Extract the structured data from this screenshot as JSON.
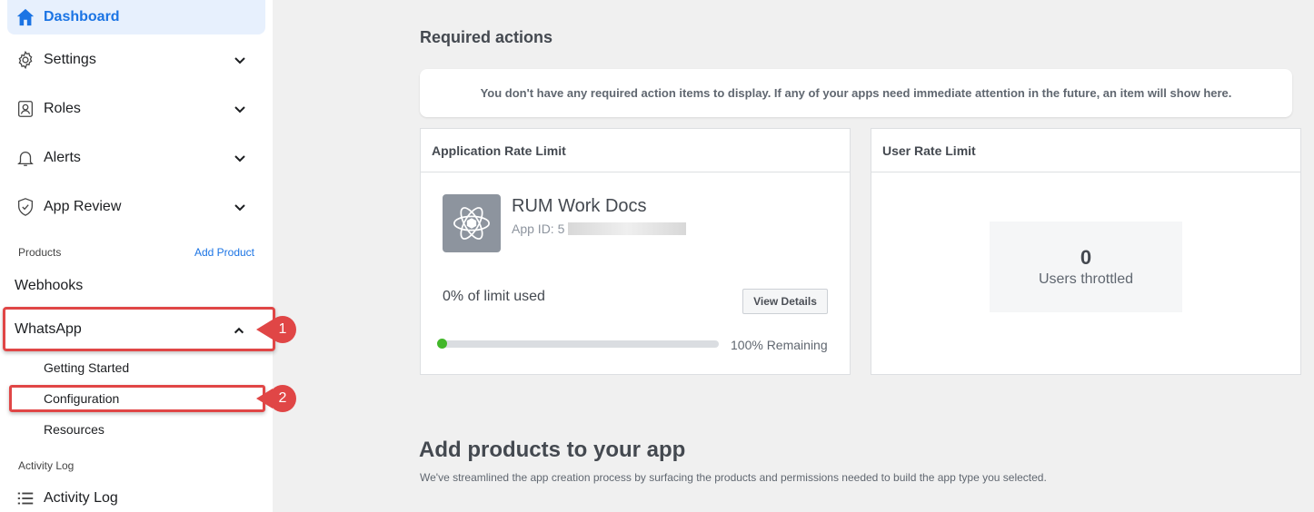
{
  "sidebar": {
    "dashboard": "Dashboard",
    "items": [
      {
        "label": "Settings",
        "icon": "gear-icon"
      },
      {
        "label": "Roles",
        "icon": "roles-icon"
      },
      {
        "label": "Alerts",
        "icon": "bell-icon"
      },
      {
        "label": "App Review",
        "icon": "shield-check-icon"
      }
    ],
    "products_heading": "Products",
    "add_product": "Add Product",
    "webhooks": "Webhooks",
    "whatsapp": "WhatsApp",
    "whatsapp_sub": [
      "Getting Started",
      "Configuration",
      "Resources"
    ],
    "activity_heading": "Activity Log",
    "activity_item": "Activity Log"
  },
  "callouts": [
    "1",
    "2"
  ],
  "main": {
    "required_title": "Required actions",
    "notice": "You don't have any required action items to display. If any of your apps need immediate attention in the future, an item will show here.",
    "app_rate": {
      "title": "Application Rate Limit",
      "app_name": "RUM Work Docs",
      "app_id_label": "App ID: 5",
      "limit_used": "0% of limit used",
      "view_details": "View Details",
      "remaining": "100% Remaining",
      "progress_fraction": 0.0
    },
    "user_rate": {
      "title": "User Rate Limit",
      "count": "0",
      "label": "Users throttled"
    },
    "add_products_title": "Add products to your app",
    "add_products_sub": "We've streamlined the app creation process by surfacing the products and permissions needed to build the app type you selected."
  },
  "colors": {
    "accent": "#1b74e4",
    "callout": "#e04646",
    "progress": "#42b72a"
  }
}
